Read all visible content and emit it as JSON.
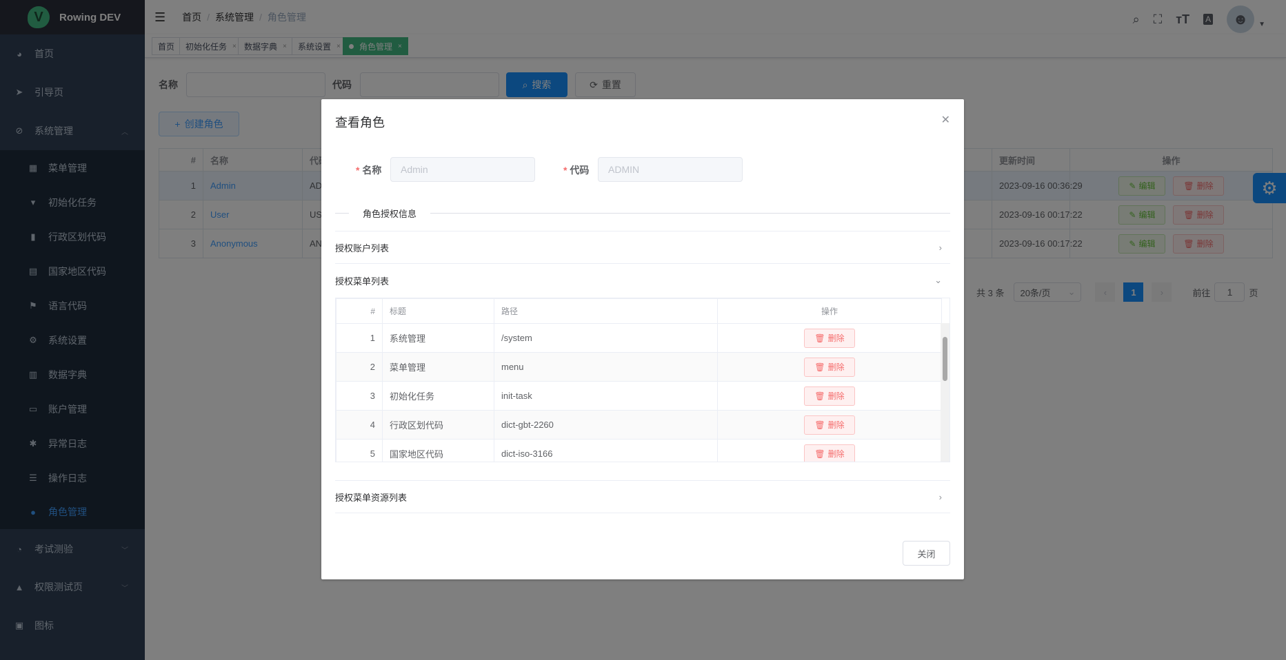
{
  "app": {
    "title": "Rowing DEV",
    "logo_letter": "V"
  },
  "sidebar": {
    "items": [
      {
        "label": "首页",
        "icon": "dashboard-icon",
        "glyph": "◕"
      },
      {
        "label": "引导页",
        "icon": "paper-plane-icon",
        "glyph": "➤"
      },
      {
        "label": "系统管理",
        "icon": "system-icon",
        "glyph": "⊘",
        "expanded": true
      },
      {
        "label": "菜单管理",
        "icon": "grid-icon",
        "glyph": "▦"
      },
      {
        "label": "初始化任务",
        "icon": "init-icon",
        "glyph": "▾"
      },
      {
        "label": "行政区划代码",
        "icon": "bar-chart-icon",
        "glyph": "▮"
      },
      {
        "label": "国家地区代码",
        "icon": "table-icon",
        "glyph": "▤"
      },
      {
        "label": "语言代码",
        "icon": "flag-icon",
        "glyph": "⚑"
      },
      {
        "label": "系统设置",
        "icon": "gear-icon",
        "glyph": "⚙"
      },
      {
        "label": "数据字典",
        "icon": "dictionary-icon",
        "glyph": "▥"
      },
      {
        "label": "账户管理",
        "icon": "card-icon",
        "glyph": "▭"
      },
      {
        "label": "异常日志",
        "icon": "bug-icon",
        "glyph": "✱"
      },
      {
        "label": "操作日志",
        "icon": "sliders-icon",
        "glyph": "☰"
      },
      {
        "label": "角色管理",
        "icon": "role-icon",
        "glyph": "●",
        "active": true
      },
      {
        "label": "考试测验",
        "icon": "speedometer-icon",
        "glyph": "◔"
      },
      {
        "label": "权限测试页",
        "icon": "lock-icon",
        "glyph": "▲"
      },
      {
        "label": "图标",
        "icon": "icon-icon",
        "glyph": "▣"
      }
    ]
  },
  "header": {
    "breadcrumb": [
      "首页",
      "系统管理",
      "角色管理"
    ],
    "separator": "/"
  },
  "tags": [
    {
      "label": "首页"
    },
    {
      "label": "初始化任务",
      "close": "×"
    },
    {
      "label": "数据字典",
      "close": "×"
    },
    {
      "label": "系统设置",
      "close": "×"
    },
    {
      "label": "角色管理",
      "close": "×",
      "active": true
    }
  ],
  "search": {
    "name_label": "名称",
    "code_label": "代码",
    "name_value": "",
    "code_value": "",
    "search_label": "搜索",
    "reset_label": "重置"
  },
  "create_label": "创建角色",
  "table": {
    "headers": [
      "#",
      "名称",
      "代码",
      "更新时间",
      "操作"
    ],
    "rows": [
      {
        "index": "1",
        "name": "Admin",
        "code": "ADMIN",
        "updated": "2023-09-16 00:36:29"
      },
      {
        "index": "2",
        "name": "User",
        "code": "USER",
        "updated": "2023-09-16 00:17:22"
      },
      {
        "index": "3",
        "name": "Anonymous",
        "code": "ANONYMOUS",
        "updated": "2023-09-16 00:17:22"
      }
    ],
    "edit_label": "编辑",
    "delete_label": "删除"
  },
  "pagination": {
    "total": "共 3 条",
    "page_size": "20条/页",
    "current": "1",
    "goto_label": "前往",
    "goto_value": "1",
    "page_suffix": "页"
  },
  "modal": {
    "title": "查看角色",
    "name_label": "名称",
    "name_value": "Admin",
    "code_label": "代码",
    "code_value": "ADMIN",
    "required_mark": "*",
    "divider": "角色授权信息",
    "sections": [
      {
        "label": "授权账户列表",
        "expanded": false
      },
      {
        "label": "授权菜单列表",
        "expanded": true
      },
      {
        "label": "授权菜单资源列表",
        "expanded": false
      }
    ],
    "menu_table": {
      "headers": [
        "#",
        "标题",
        "路径",
        "操作"
      ],
      "rows": [
        {
          "index": "1",
          "title": "系统管理",
          "path": "/system"
        },
        {
          "index": "2",
          "title": "菜单管理",
          "path": "menu"
        },
        {
          "index": "3",
          "title": "初始化任务",
          "path": "init-task"
        },
        {
          "index": "4",
          "title": "行政区划代码",
          "path": "dict-gbt-2260"
        },
        {
          "index": "5",
          "title": "国家地区代码",
          "path": "dict-iso-3166"
        }
      ],
      "delete_label": "删除"
    },
    "close_label": "关闭"
  },
  "colors": {
    "primary": "#1890ff",
    "sidebar": "#304156",
    "active_tag": "#42b983",
    "danger": "#f56c6c",
    "success": "#67c23a"
  }
}
